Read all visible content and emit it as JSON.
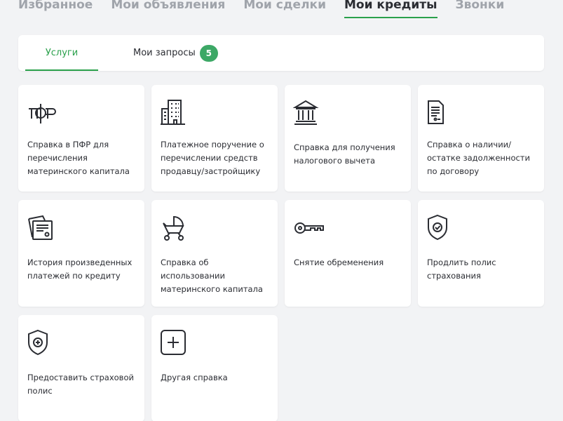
{
  "top_nav": {
    "items": [
      "Избранное",
      "Мои объявления",
      "Мои сделки",
      "Мои кредиты",
      "Звонки"
    ],
    "active_index": 3
  },
  "tabs": {
    "services": "Услуги",
    "requests": "Мои запросы",
    "requests_count": "5"
  },
  "accent_color": "#2aa04b",
  "cards": [
    {
      "icon": "pfr-logo-icon",
      "label": "Справка в ПФР для перечисления материнского капитала"
    },
    {
      "icon": "building-icon",
      "label": "Платежное поручение о перечислении средств продавцу/застройщику"
    },
    {
      "icon": "bank-icon",
      "label": "Справка для получения налогового вычета"
    },
    {
      "icon": "document-icon",
      "label": "Справка о наличии/ остатке задолженности по договору"
    },
    {
      "icon": "payment-history-icon",
      "label": "История произведенных платежей по кредиту"
    },
    {
      "icon": "baby-stroller-icon",
      "label": "Справка об использовании материнского капитала"
    },
    {
      "icon": "key-icon",
      "label": "Снятие обременения"
    },
    {
      "icon": "shield-check-icon",
      "label": "Продлить полис страхования"
    },
    {
      "icon": "shield-plus-icon",
      "label": "Предоставить страховой полис"
    },
    {
      "icon": "plus-box-icon",
      "label": "Другая справка"
    }
  ]
}
